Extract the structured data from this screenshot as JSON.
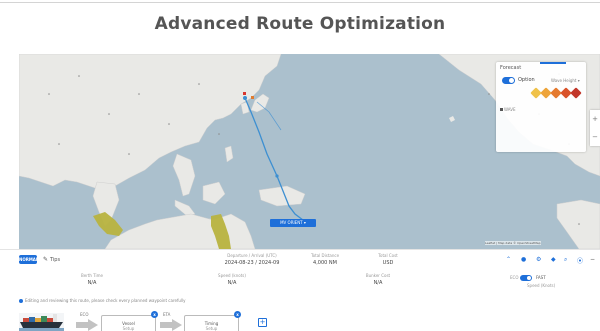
{
  "page": {
    "title": "Advanced Route Optimization"
  },
  "map": {
    "vessel_label": "MV ORIENT ▾",
    "attribution": "Leaflet | Map data © OpenStreetMap",
    "zoom_in": "+",
    "zoom_out": "−",
    "forecast": {
      "title": "Forecast",
      "option": "Option",
      "dropdown": "Wave Height ▾",
      "legend": "WAVE",
      "wave_colors": [
        "#f0c24a",
        "#eea43a",
        "#e57a2e",
        "#d9532a",
        "#c2372a"
      ]
    },
    "colors": {
      "sea": "#abc0cd",
      "land": "#e9e9e6",
      "route": "#3d8fd1"
    }
  },
  "info_bar": {
    "route_badge": "NORMAL",
    "tips_icon": "✎",
    "tips_label": "Tips",
    "top_stats": [
      {
        "label": "Departure / Arrival (UTC)",
        "value": "2024-08-23 / 2024-09"
      },
      {
        "label": "Total Distance",
        "value": "4,000 NM"
      },
      {
        "label": "Total Cost",
        "value": "USD"
      }
    ],
    "bottom_stats": [
      {
        "label": "Berth Time",
        "value": "N/A"
      },
      {
        "label": "Speed (knots)",
        "value": "N/A"
      },
      {
        "label": "Bunker Cost",
        "value": "N/A"
      }
    ],
    "toolbar_icons": [
      "⌃",
      "●",
      "⚙",
      "◆",
      "⌕",
      "⦿",
      "−"
    ],
    "vessel_toggle": {
      "left": "ECO",
      "right": "FAST",
      "sub": "Speed (Knots)"
    },
    "note": "Editing and reviewing this route, please check every planned waypoint carefully"
  },
  "workflow": {
    "stages": [
      {
        "tag": "ECO",
        "line1": "Vessel",
        "line2": "Setup",
        "badge": "x"
      },
      {
        "tag": "ETA",
        "line1": "Timing",
        "line2": "Setup",
        "badge": "x"
      }
    ],
    "add_label": "+"
  }
}
